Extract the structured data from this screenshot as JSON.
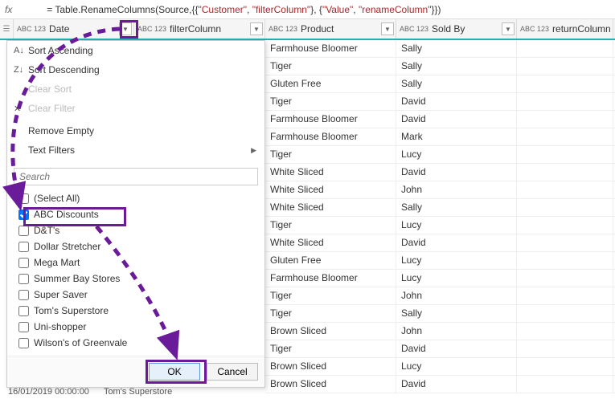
{
  "formula": {
    "prefix": "= Table.RenameColumns(Source,{{",
    "s1": "\"Customer\"",
    "c1": ", ",
    "s2": "\"filterColumn\"",
    "c2": "}, {",
    "s3": "\"Value\"",
    "c3": ", ",
    "s4": "\"renameColumn\"",
    "suffix": "}})"
  },
  "type_icon": "ABC\n123",
  "columns": {
    "date": "Date",
    "filter": "filterColumn",
    "product": "Product",
    "soldby": "Sold By",
    "return": "returnColumn"
  },
  "menu": {
    "sort_asc": "Sort Ascending",
    "sort_desc": "Sort Descending",
    "clear_sort": "Clear Sort",
    "clear_filter": "Clear Filter",
    "remove_empty": "Remove Empty",
    "text_filters": "Text Filters",
    "search_placeholder": "Search",
    "select_all": "(Select All)",
    "items": [
      "ABC Discounts",
      "D&T's",
      "Dollar Stretcher",
      "Mega Mart",
      "Summer Bay Stores",
      "Super Saver",
      "Tom's Superstore",
      "Uni-shopper",
      "Wilson's of Greenvale"
    ],
    "ok": "OK",
    "cancel": "Cancel"
  },
  "rows": [
    {
      "product": "Farmhouse Bloomer",
      "soldby": "Sally"
    },
    {
      "product": "Tiger",
      "soldby": "Sally"
    },
    {
      "product": "Gluten Free",
      "soldby": "Sally"
    },
    {
      "product": "Tiger",
      "soldby": "David"
    },
    {
      "product": "Farmhouse Bloomer",
      "soldby": "David"
    },
    {
      "product": "Farmhouse Bloomer",
      "soldby": "Mark"
    },
    {
      "product": "Tiger",
      "soldby": "Lucy"
    },
    {
      "product": "White Sliced",
      "soldby": "David"
    },
    {
      "product": "White Sliced",
      "soldby": "John"
    },
    {
      "product": "White Sliced",
      "soldby": "Sally"
    },
    {
      "product": "Tiger",
      "soldby": "Lucy"
    },
    {
      "product": "White Sliced",
      "soldby": "David"
    },
    {
      "product": "Gluten Free",
      "soldby": "Lucy"
    },
    {
      "product": "Farmhouse Bloomer",
      "soldby": "Lucy"
    },
    {
      "product": "Tiger",
      "soldby": "John"
    },
    {
      "product": "Tiger",
      "soldby": "Sally"
    },
    {
      "product": "Brown Sliced",
      "soldby": "John"
    },
    {
      "product": "Tiger",
      "soldby": "David"
    },
    {
      "product": "Brown Sliced",
      "soldby": "Lucy"
    },
    {
      "product": "Brown Sliced",
      "soldby": "David"
    }
  ],
  "bottom": {
    "date": "16/01/2019 00:00:00",
    "customer": "Tom's Superstore"
  },
  "colors": {
    "accent": "#20B2AA",
    "annotation": "#6a1b9a"
  }
}
